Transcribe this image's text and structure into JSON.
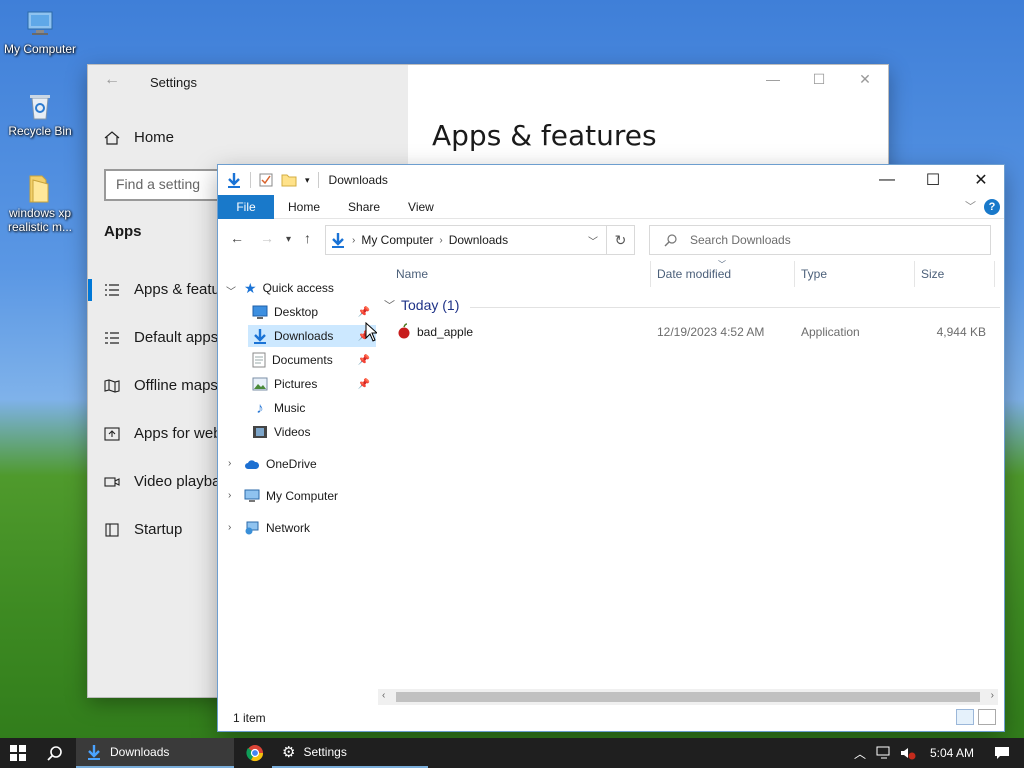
{
  "desktop": {
    "icons": [
      {
        "label": "My Computer"
      },
      {
        "label": "Recycle Bin"
      },
      {
        "label": "windows xp realistic m..."
      }
    ]
  },
  "settings": {
    "title": "Settings",
    "home": "Home",
    "search_placeholder": "Find a setting",
    "section": "Apps",
    "nav": [
      {
        "label": "Apps & features"
      },
      {
        "label": "Default apps"
      },
      {
        "label": "Offline maps"
      },
      {
        "label": "Apps for websites"
      },
      {
        "label": "Video playback"
      },
      {
        "label": "Startup"
      }
    ],
    "heading": "Apps & features"
  },
  "explorer": {
    "title": "Downloads",
    "ribbon_tabs": [
      "File",
      "Home",
      "Share",
      "View"
    ],
    "help": "?",
    "breadcrumb": [
      "My Computer",
      "Downloads"
    ],
    "search_placeholder": "Search Downloads",
    "tree": {
      "quick_access": "Quick access",
      "pinned": [
        {
          "label": "Desktop"
        },
        {
          "label": "Downloads"
        },
        {
          "label": "Documents"
        },
        {
          "label": "Pictures"
        },
        {
          "label": "Music"
        },
        {
          "label": "Videos"
        }
      ],
      "onedrive": "OneDrive",
      "my_computer": "My Computer",
      "network": "Network"
    },
    "columns": [
      "Name",
      "Date modified",
      "Type",
      "Size"
    ],
    "group": "Today (1)",
    "files": [
      {
        "name": "bad_apple",
        "date": "12/19/2023 4:52 AM",
        "type": "Application",
        "size": "4,944 KB"
      }
    ],
    "status": "1 item"
  },
  "taskbar": {
    "tasks": [
      {
        "label": "Downloads"
      },
      {
        "label": "Settings"
      }
    ],
    "clock": "5:04 AM"
  },
  "colors": {
    "accent": "#0078d7",
    "selection": "#cce8ff",
    "file_tab": "#1979ca"
  }
}
